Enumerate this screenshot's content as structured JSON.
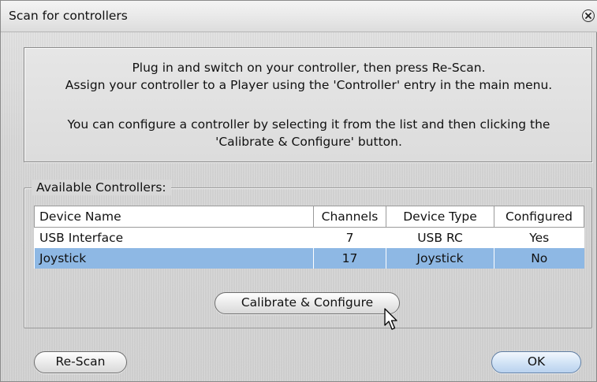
{
  "window": {
    "title": "Scan for controllers",
    "close_icon": "close-icon"
  },
  "info": {
    "line1": "Plug in and switch on your controller, then press Re-Scan.",
    "line2": "Assign your controller to a Player using the 'Controller' entry in the main menu.",
    "line3": "You can configure a controller by selecting it from the list and then clicking the",
    "line4": "'Calibrate & Configure' button."
  },
  "controllers": {
    "legend": "Available Controllers:",
    "columns": [
      "Device Name",
      "Channels",
      "Device Type",
      "Configured"
    ],
    "rows": [
      {
        "name": "USB Interface",
        "channels": "7",
        "type": "USB RC",
        "configured": "Yes"
      },
      {
        "name": "Joystick",
        "channels": "17",
        "type": "Joystick",
        "configured": "No",
        "selected": true
      }
    ]
  },
  "buttons": {
    "calibrate": "Calibrate & Configure",
    "rescan": "Re-Scan",
    "ok": "OK"
  },
  "colors": {
    "selection": "#8eb8e4",
    "default_button": "#b9d2ee"
  }
}
